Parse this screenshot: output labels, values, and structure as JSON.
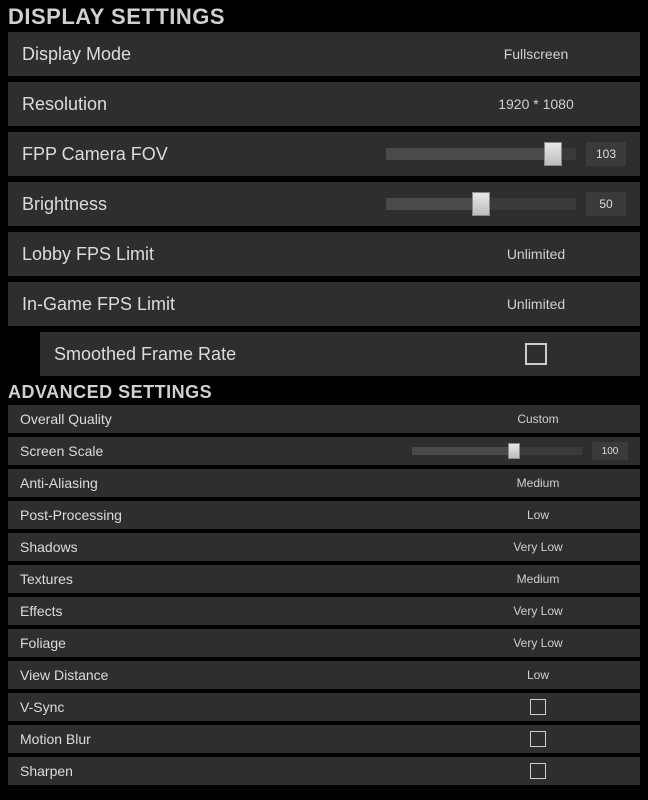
{
  "display": {
    "header": "DISPLAY SETTINGS",
    "rows": {
      "mode": {
        "label": "Display Mode",
        "value": "Fullscreen"
      },
      "resolution": {
        "label": "Resolution",
        "value": "1920 * 1080"
      },
      "fov": {
        "label": "FPP Camera FOV",
        "value": "103",
        "pct": 88
      },
      "brightness": {
        "label": "Brightness",
        "value": "50",
        "pct": 50
      },
      "lobby_fps": {
        "label": "Lobby FPS Limit",
        "value": "Unlimited"
      },
      "ingame_fps": {
        "label": "In-Game FPS Limit",
        "value": "Unlimited"
      },
      "smoothed": {
        "label": "Smoothed Frame Rate"
      }
    }
  },
  "advanced": {
    "header": "ADVANCED SETTINGS",
    "rows": {
      "overall": {
        "label": "Overall Quality",
        "value": "Custom"
      },
      "scale": {
        "label": "Screen Scale",
        "value": "100",
        "pct": 60
      },
      "aa": {
        "label": "Anti-Aliasing",
        "value": "Medium"
      },
      "post": {
        "label": "Post-Processing",
        "value": "Low"
      },
      "shadows": {
        "label": "Shadows",
        "value": "Very Low"
      },
      "textures": {
        "label": "Textures",
        "value": "Medium"
      },
      "effects": {
        "label": "Effects",
        "value": "Very Low"
      },
      "foliage": {
        "label": "Foliage",
        "value": "Very Low"
      },
      "viewdist": {
        "label": "View Distance",
        "value": "Low"
      },
      "vsync": {
        "label": "V-Sync"
      },
      "mblur": {
        "label": "Motion Blur"
      },
      "sharpen": {
        "label": "Sharpen"
      }
    }
  }
}
